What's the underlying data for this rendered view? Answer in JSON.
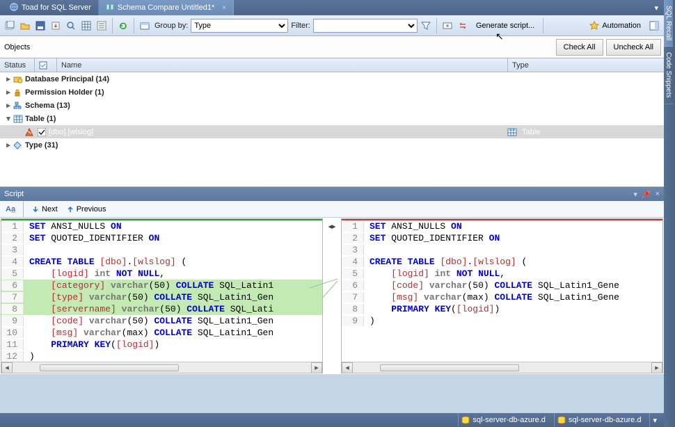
{
  "tabs": {
    "main": "Toad for SQL Server",
    "doc": "Schema Compare Untitled1*"
  },
  "toolbar": {
    "groupby_label": "Group by:",
    "groupby_value": "Type",
    "filter_label": "Filter:",
    "filter_value": "",
    "generate": "Generate script...",
    "automation": "Automation"
  },
  "objects": {
    "title": "Objects",
    "check_all": "Check All",
    "uncheck_all": "Uncheck All"
  },
  "grid": {
    "status": "Status",
    "name": "Name",
    "type": "Type"
  },
  "tree": {
    "r0": "Database Principal (14)",
    "r1": "Permission Holder (1)",
    "r2": "Schema (13)",
    "r3": "Table (1)",
    "r4": "[dbo].[wlslog]",
    "r4_type": "Table",
    "r5": "Type (31)"
  },
  "script": {
    "title": "Script",
    "next": "Next",
    "prev": "Previous"
  },
  "code_left": [
    "SET ANSI_NULLS ON",
    "SET QUOTED_IDENTIFIER ON",
    "",
    "CREATE TABLE [dbo].[wlslog] (",
    "    [logid] int NOT NULL,",
    "    [category] varchar(50) COLLATE SQL_Latin1",
    "    [type] varchar(50) COLLATE SQL_Latin1_Gen",
    "    [servername] varchar(50) COLLATE SQL_Lati",
    "    [code] varchar(50) COLLATE SQL_Latin1_Gen",
    "    [msg] varchar(max) COLLATE SQL_Latin1_Gen",
    "    PRIMARY KEY([logid])",
    ")"
  ],
  "code_right": [
    "SET ANSI_NULLS ON",
    "SET QUOTED_IDENTIFIER ON",
    "",
    "CREATE TABLE [dbo].[wlslog] (",
    "    [logid] int NOT NULL,",
    "    [code] varchar(50) COLLATE SQL_Latin1_Gene",
    "    [msg] varchar(max) COLLATE SQL_Latin1_Gene",
    "    PRIMARY KEY([logid])",
    ")"
  ],
  "statusbar": {
    "conn1": "sql-server-db-azure.d",
    "conn2": "sql-server-db-azure.d"
  },
  "rail": {
    "recall": "SQL Recall",
    "snippets": "Code Snippets"
  }
}
